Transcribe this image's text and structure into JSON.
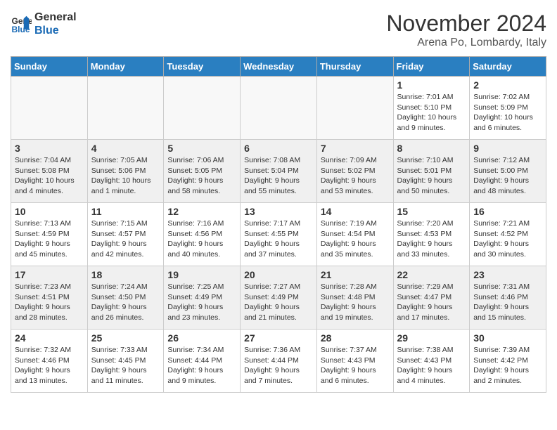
{
  "header": {
    "logo_line1": "General",
    "logo_line2": "Blue",
    "month_title": "November 2024",
    "location": "Arena Po, Lombardy, Italy"
  },
  "weekdays": [
    "Sunday",
    "Monday",
    "Tuesday",
    "Wednesday",
    "Thursday",
    "Friday",
    "Saturday"
  ],
  "weeks": [
    {
      "days": [
        {
          "num": "",
          "info": ""
        },
        {
          "num": "",
          "info": ""
        },
        {
          "num": "",
          "info": ""
        },
        {
          "num": "",
          "info": ""
        },
        {
          "num": "",
          "info": ""
        },
        {
          "num": "1",
          "info": "Sunrise: 7:01 AM\nSunset: 5:10 PM\nDaylight: 10 hours\nand 9 minutes."
        },
        {
          "num": "2",
          "info": "Sunrise: 7:02 AM\nSunset: 5:09 PM\nDaylight: 10 hours\nand 6 minutes."
        }
      ]
    },
    {
      "days": [
        {
          "num": "3",
          "info": "Sunrise: 7:04 AM\nSunset: 5:08 PM\nDaylight: 10 hours\nand 4 minutes."
        },
        {
          "num": "4",
          "info": "Sunrise: 7:05 AM\nSunset: 5:06 PM\nDaylight: 10 hours\nand 1 minute."
        },
        {
          "num": "5",
          "info": "Sunrise: 7:06 AM\nSunset: 5:05 PM\nDaylight: 9 hours\nand 58 minutes."
        },
        {
          "num": "6",
          "info": "Sunrise: 7:08 AM\nSunset: 5:04 PM\nDaylight: 9 hours\nand 55 minutes."
        },
        {
          "num": "7",
          "info": "Sunrise: 7:09 AM\nSunset: 5:02 PM\nDaylight: 9 hours\nand 53 minutes."
        },
        {
          "num": "8",
          "info": "Sunrise: 7:10 AM\nSunset: 5:01 PM\nDaylight: 9 hours\nand 50 minutes."
        },
        {
          "num": "9",
          "info": "Sunrise: 7:12 AM\nSunset: 5:00 PM\nDaylight: 9 hours\nand 48 minutes."
        }
      ]
    },
    {
      "days": [
        {
          "num": "10",
          "info": "Sunrise: 7:13 AM\nSunset: 4:59 PM\nDaylight: 9 hours\nand 45 minutes."
        },
        {
          "num": "11",
          "info": "Sunrise: 7:15 AM\nSunset: 4:57 PM\nDaylight: 9 hours\nand 42 minutes."
        },
        {
          "num": "12",
          "info": "Sunrise: 7:16 AM\nSunset: 4:56 PM\nDaylight: 9 hours\nand 40 minutes."
        },
        {
          "num": "13",
          "info": "Sunrise: 7:17 AM\nSunset: 4:55 PM\nDaylight: 9 hours\nand 37 minutes."
        },
        {
          "num": "14",
          "info": "Sunrise: 7:19 AM\nSunset: 4:54 PM\nDaylight: 9 hours\nand 35 minutes."
        },
        {
          "num": "15",
          "info": "Sunrise: 7:20 AM\nSunset: 4:53 PM\nDaylight: 9 hours\nand 33 minutes."
        },
        {
          "num": "16",
          "info": "Sunrise: 7:21 AM\nSunset: 4:52 PM\nDaylight: 9 hours\nand 30 minutes."
        }
      ]
    },
    {
      "days": [
        {
          "num": "17",
          "info": "Sunrise: 7:23 AM\nSunset: 4:51 PM\nDaylight: 9 hours\nand 28 minutes."
        },
        {
          "num": "18",
          "info": "Sunrise: 7:24 AM\nSunset: 4:50 PM\nDaylight: 9 hours\nand 26 minutes."
        },
        {
          "num": "19",
          "info": "Sunrise: 7:25 AM\nSunset: 4:49 PM\nDaylight: 9 hours\nand 23 minutes."
        },
        {
          "num": "20",
          "info": "Sunrise: 7:27 AM\nSunset: 4:49 PM\nDaylight: 9 hours\nand 21 minutes."
        },
        {
          "num": "21",
          "info": "Sunrise: 7:28 AM\nSunset: 4:48 PM\nDaylight: 9 hours\nand 19 minutes."
        },
        {
          "num": "22",
          "info": "Sunrise: 7:29 AM\nSunset: 4:47 PM\nDaylight: 9 hours\nand 17 minutes."
        },
        {
          "num": "23",
          "info": "Sunrise: 7:31 AM\nSunset: 4:46 PM\nDaylight: 9 hours\nand 15 minutes."
        }
      ]
    },
    {
      "days": [
        {
          "num": "24",
          "info": "Sunrise: 7:32 AM\nSunset: 4:46 PM\nDaylight: 9 hours\nand 13 minutes."
        },
        {
          "num": "25",
          "info": "Sunrise: 7:33 AM\nSunset: 4:45 PM\nDaylight: 9 hours\nand 11 minutes."
        },
        {
          "num": "26",
          "info": "Sunrise: 7:34 AM\nSunset: 4:44 PM\nDaylight: 9 hours\nand 9 minutes."
        },
        {
          "num": "27",
          "info": "Sunrise: 7:36 AM\nSunset: 4:44 PM\nDaylight: 9 hours\nand 7 minutes."
        },
        {
          "num": "28",
          "info": "Sunrise: 7:37 AM\nSunset: 4:43 PM\nDaylight: 9 hours\nand 6 minutes."
        },
        {
          "num": "29",
          "info": "Sunrise: 7:38 AM\nSunset: 4:43 PM\nDaylight: 9 hours\nand 4 minutes."
        },
        {
          "num": "30",
          "info": "Sunrise: 7:39 AM\nSunset: 4:42 PM\nDaylight: 9 hours\nand 2 minutes."
        }
      ]
    }
  ]
}
